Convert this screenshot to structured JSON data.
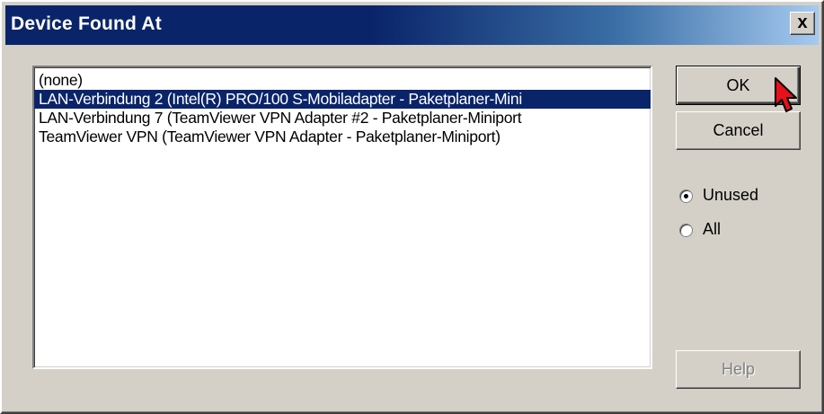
{
  "window": {
    "title": "Device Found At",
    "close_glyph": "x"
  },
  "list": {
    "items": [
      {
        "label": "(none)",
        "selected": false
      },
      {
        "label": "LAN-Verbindung 2 (Intel(R) PRO/100 S-Mobiladapter - Paketplaner-Mini",
        "selected": true
      },
      {
        "label": "LAN-Verbindung 7 (TeamViewer VPN Adapter #2 - Paketplaner-Miniport",
        "selected": false
      },
      {
        "label": "TeamViewer VPN (TeamViewer VPN Adapter - Paketplaner-Miniport)",
        "selected": false
      }
    ]
  },
  "buttons": {
    "ok_label": "OK",
    "cancel_label": "Cancel",
    "help_label": "Help"
  },
  "filter": {
    "options": [
      {
        "label": "Unused",
        "checked": true
      },
      {
        "label": "All",
        "checked": false
      }
    ]
  },
  "colors": {
    "title_active": "#0a246a",
    "selection": "#0a246a",
    "face": "#d4d0c8",
    "cursor_fill": "#e8101a"
  },
  "icons": {
    "cursor": "mouse-pointer-icon",
    "close": "close-icon"
  }
}
